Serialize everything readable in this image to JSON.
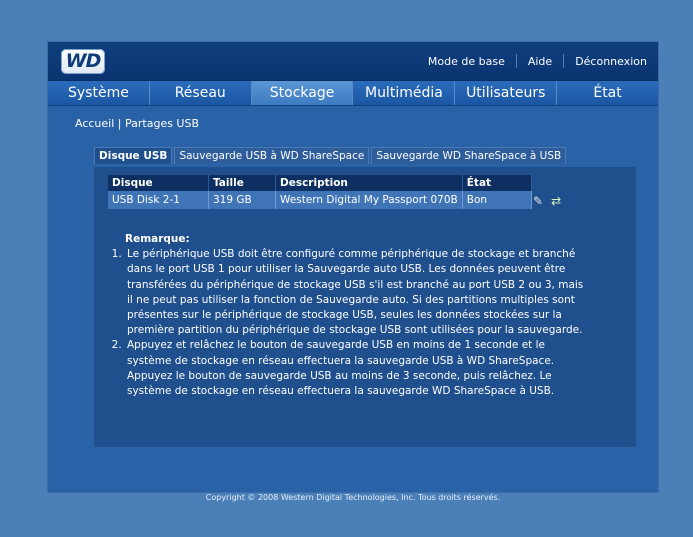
{
  "brand": {
    "logo_text": "WD"
  },
  "header": {
    "links": [
      "Mode de base",
      "Aide",
      "Déconnexion"
    ]
  },
  "nav": {
    "tabs": [
      "Système",
      "Réseau",
      "Stockage",
      "Multimédia",
      "Utilisateurs",
      "État"
    ],
    "active": "Stockage"
  },
  "breadcrumb": {
    "home": "Accueil",
    "separator": "|",
    "current": "Partages USB"
  },
  "subtabs": {
    "items": [
      "Disque USB",
      "Sauvegarde USB à WD ShareSpace",
      "Sauvegarde WD ShareSpace à USB"
    ],
    "active": "Disque USB"
  },
  "table": {
    "headers": [
      "Disque",
      "Taille",
      "Description",
      "État"
    ],
    "rows": [
      {
        "disque": "USB Disk 2-1",
        "taille": "319 GB",
        "description": "Western Digital My Passport 070B",
        "etat": "Bon"
      }
    ],
    "action_icons": [
      "edit-icon",
      "change-icon"
    ]
  },
  "remark": {
    "title": "Remarque:",
    "items": [
      "Le périphérique USB doit être configuré comme périphérique de stockage et branché dans le port USB 1 pour utiliser la Sauvegarde auto USB. Les données peuvent être transférées du périphérique de stockage USB s'il est branché au port USB 2 ou 3, mais il ne peut pas utiliser la fonction de Sauvegarde auto. Si des partitions multiples sont présentes sur le périphérique de stockage USB, seules les données stockées sur la première partition du périphérique de stockage USB sont utilisées pour la sauvegarde.",
      "Appuyez et relâchez le bouton de sauvegarde USB en moins de 1 seconde et le système de stockage en réseau effectuera la sauvegarde USB à WD ShareSpace. Appuyez le bouton de sauvegarde USB au moins de 3 seconde, puis relâchez. Le système de stockage en réseau effectuera la sauvegarde WD ShareSpace à USB."
    ]
  },
  "footer": {
    "copyright": "Copyright © 2008 Western Digital Technologies, Inc. Tous droits réservés."
  },
  "colors": {
    "page_background": "#4a7fb8",
    "app_background": "#2a62a8",
    "topbar": "#0f3f7e",
    "nav_active": "#4b89cb",
    "panel": "#1f4f8d",
    "table_header": "#0d2f62",
    "table_row": "#3f75b7"
  }
}
